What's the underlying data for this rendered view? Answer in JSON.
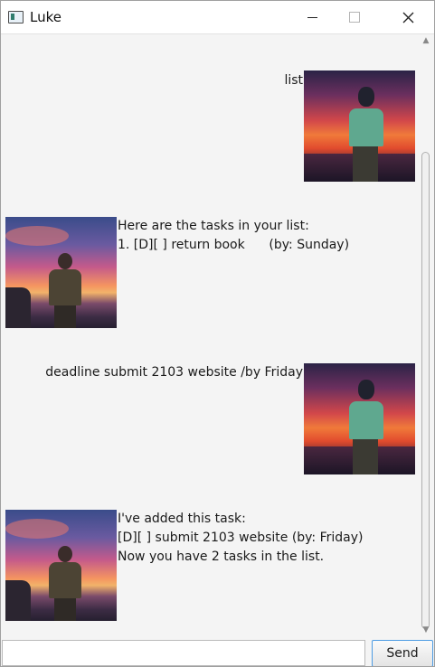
{
  "window": {
    "title": "Luke"
  },
  "dialog": {
    "messages": [
      {
        "sender": "user",
        "lines": [
          "list"
        ]
      },
      {
        "sender": "bot",
        "lines": [
          "Here are the tasks in your list:",
          "1. [D][ ] return book      (by: Sunday)"
        ]
      },
      {
        "sender": "user",
        "lines": [
          "deadline submit 2103 website /by Friday"
        ]
      },
      {
        "sender": "bot",
        "lines": [
          "I've added this task:",
          "[D][ ] submit 2103 website (by: Friday)",
          "Now you have 2 tasks in the list."
        ]
      }
    ]
  },
  "input": {
    "value": "",
    "placeholder": ""
  },
  "send_button": {
    "label": "Send"
  },
  "colors": {
    "background": "#f4f4f4",
    "send_border": "#4c9be3"
  }
}
